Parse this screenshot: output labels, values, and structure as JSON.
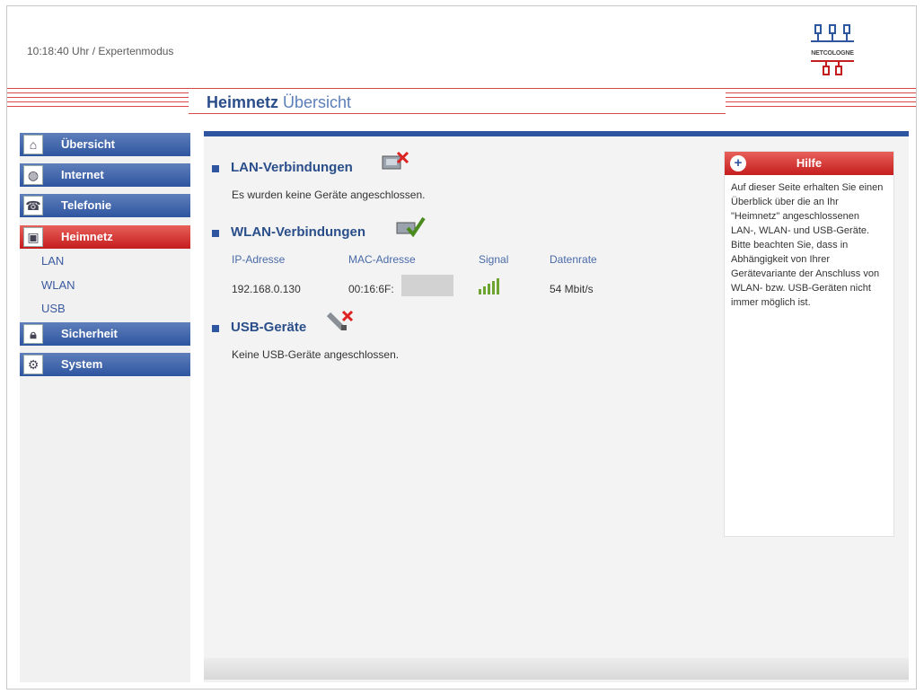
{
  "header": {
    "status": "10:18:40 Uhr  / Expertenmodus",
    "logo_text": "NETCOLOGNE",
    "page_title_bold": "Heimnetz",
    "page_title_rest": "Übersicht"
  },
  "sidebar": {
    "items": [
      {
        "label": "Übersicht",
        "icon": "home-icon"
      },
      {
        "label": "Internet",
        "icon": "globe-icon"
      },
      {
        "label": "Telefonie",
        "icon": "phone-icon"
      },
      {
        "label": "Heimnetz",
        "icon": "network-icon"
      },
      {
        "label": "Sicherheit",
        "icon": "lock-icon"
      },
      {
        "label": "System",
        "icon": "gear-icon"
      }
    ],
    "sub_items": [
      "LAN",
      "WLAN",
      "USB"
    ]
  },
  "main": {
    "lan": {
      "title": "LAN-Verbindungen",
      "text": "Es wurden keine Geräte angeschlossen."
    },
    "wlan": {
      "title": "WLAN-Verbindungen",
      "columns": [
        "IP-Adresse",
        "MAC-Adresse",
        "Signal",
        "Datenrate"
      ],
      "rows": [
        {
          "ip": "192.168.0.130",
          "mac": "00:16:6F:",
          "signal_level": 5,
          "rate": "54 Mbit/s"
        }
      ]
    },
    "usb": {
      "title": "USB-Geräte",
      "text": "Keine USB-Geräte angeschlossen."
    }
  },
  "help": {
    "title": "Hilfe",
    "text": "Auf dieser Seite erhalten Sie einen Überblick über die an Ihr \"Heimnetz\" angeschlossenen LAN-, WLAN- und USB-Geräte. Bitte beachten Sie, dass in Abhängigkeit von Ihrer Gerätevariante der Anschluss von WLAN- bzw. USB-Geräten nicht immer möglich ist."
  },
  "colors": {
    "nav_blue": "#2e55a0",
    "active_red": "#c41d1d",
    "stripe_red": "#d84a4a",
    "signal_green": "#6ca331"
  }
}
